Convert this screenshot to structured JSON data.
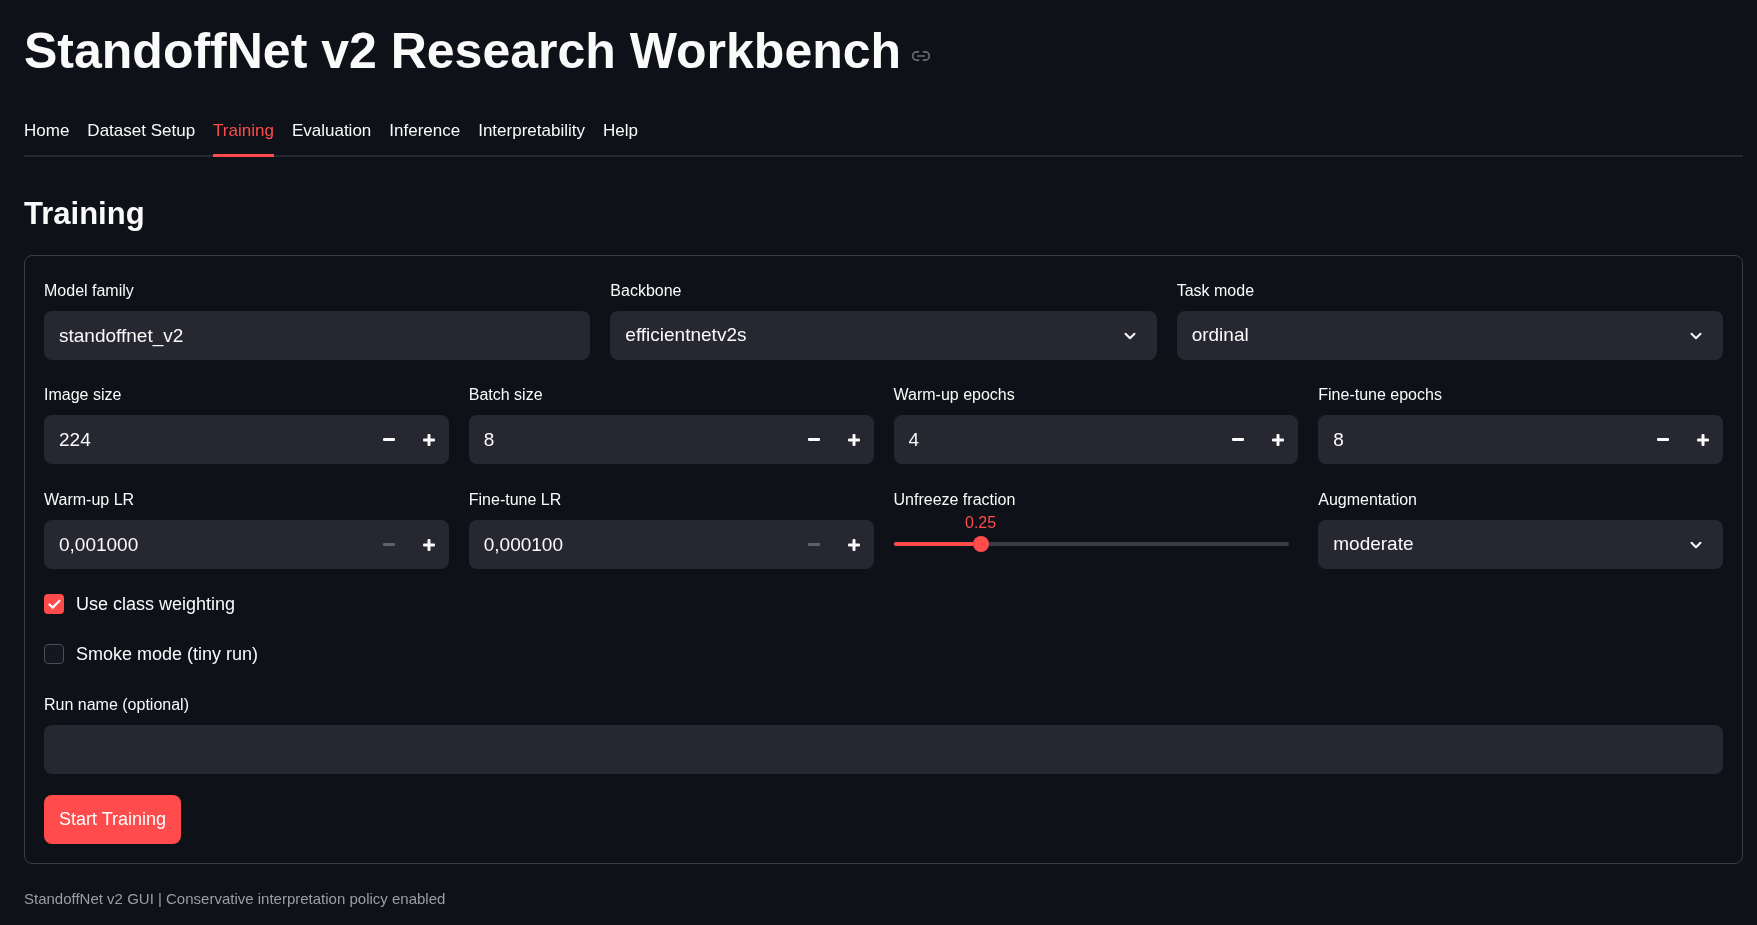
{
  "header": {
    "title": "StandoffNet v2 Research Workbench"
  },
  "tabs": [
    {
      "label": "Home",
      "selected": false
    },
    {
      "label": "Dataset Setup",
      "selected": false
    },
    {
      "label": "Training",
      "selected": true
    },
    {
      "label": "Evaluation",
      "selected": false
    },
    {
      "label": "Inference",
      "selected": false
    },
    {
      "label": "Interpretability",
      "selected": false
    },
    {
      "label": "Help",
      "selected": false
    }
  ],
  "section": {
    "title": "Training"
  },
  "form": {
    "rows": [
      {
        "fields": [
          {
            "kind": "text",
            "label": "Model family",
            "value": "standoffnet_v2"
          },
          {
            "kind": "select",
            "label": "Backbone",
            "value": "efficientnetv2s"
          },
          {
            "kind": "select",
            "label": "Task mode",
            "value": "ordinal"
          }
        ]
      },
      {
        "fields": [
          {
            "kind": "number",
            "label": "Image size",
            "value": "224",
            "decrement_disabled": false
          },
          {
            "kind": "number",
            "label": "Batch size",
            "value": "8",
            "decrement_disabled": false
          },
          {
            "kind": "number",
            "label": "Warm-up epochs",
            "value": "4",
            "decrement_disabled": false
          },
          {
            "kind": "number",
            "label": "Fine-tune epochs",
            "value": "8",
            "decrement_disabled": false
          }
        ]
      },
      {
        "fields": [
          {
            "kind": "number",
            "label": "Warm-up LR",
            "value": "0,001000",
            "decrement_disabled": true
          },
          {
            "kind": "number",
            "label": "Fine-tune LR",
            "value": "0,000100",
            "decrement_disabled": true
          },
          {
            "kind": "slider",
            "label": "Unfreeze fraction",
            "reading": "0.25",
            "level": 0.22
          },
          {
            "kind": "select",
            "label": "Augmentation",
            "value": "moderate"
          }
        ]
      }
    ],
    "checkboxes": [
      {
        "label": "Use class weighting",
        "checked": true
      },
      {
        "label": "Smoke mode (tiny run)",
        "checked": false
      }
    ],
    "run_name": {
      "label": "Run name (optional)"
    },
    "submit": {
      "label": "Start Training"
    }
  },
  "footer": {
    "text": "StandoffNet v2 GUI | Conservative interpretation policy enabled"
  }
}
